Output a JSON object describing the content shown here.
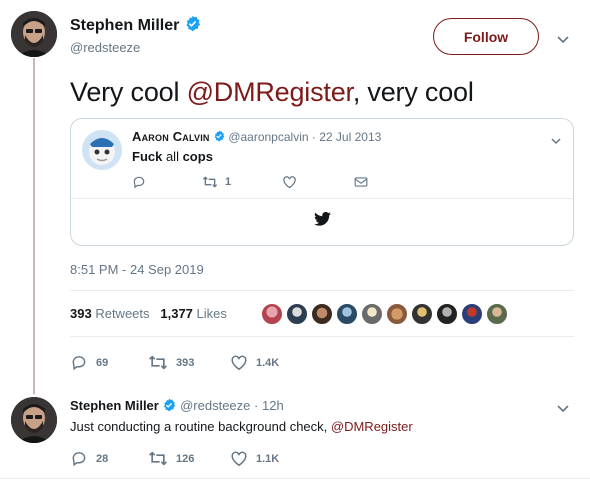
{
  "tweet": {
    "author_name": "Stephen Miller",
    "author_handle": "@redsteeze",
    "follow_label": "Follow",
    "text_prefix": "Very cool ",
    "text_mention": "@DMRegister",
    "text_suffix": ", very cool",
    "timestamp": "8:51 PM - 24 Sep 2019",
    "retweets_count": "393",
    "retweets_label": "Retweets",
    "likes_count": "1,377",
    "likes_label": "Likes",
    "reply_count": "69",
    "retweet_action_count": "393",
    "like_action_count": "1.4K"
  },
  "quoted": {
    "author_name": "Aaron Calvin",
    "author_handle": "@aaronpcalvin",
    "date_sep": "·",
    "date": "22 Jul 2013",
    "text_bold1": "Fuck",
    "text_light": " all ",
    "text_bold2": "cops",
    "retweet_count": "1"
  },
  "reply": {
    "author_name": "Stephen Miller",
    "author_handle": "@redsteeze",
    "time_sep": "·",
    "time": "12h",
    "text_prefix": "Just conducting a routine background check, ",
    "text_mention": "@DMRegister",
    "reply_count": "28",
    "retweet_count": "126",
    "like_count": "1.1K"
  },
  "colors": {
    "accent": "#7d1a1a",
    "verified": "#1da1f2",
    "muted": "#657786"
  }
}
